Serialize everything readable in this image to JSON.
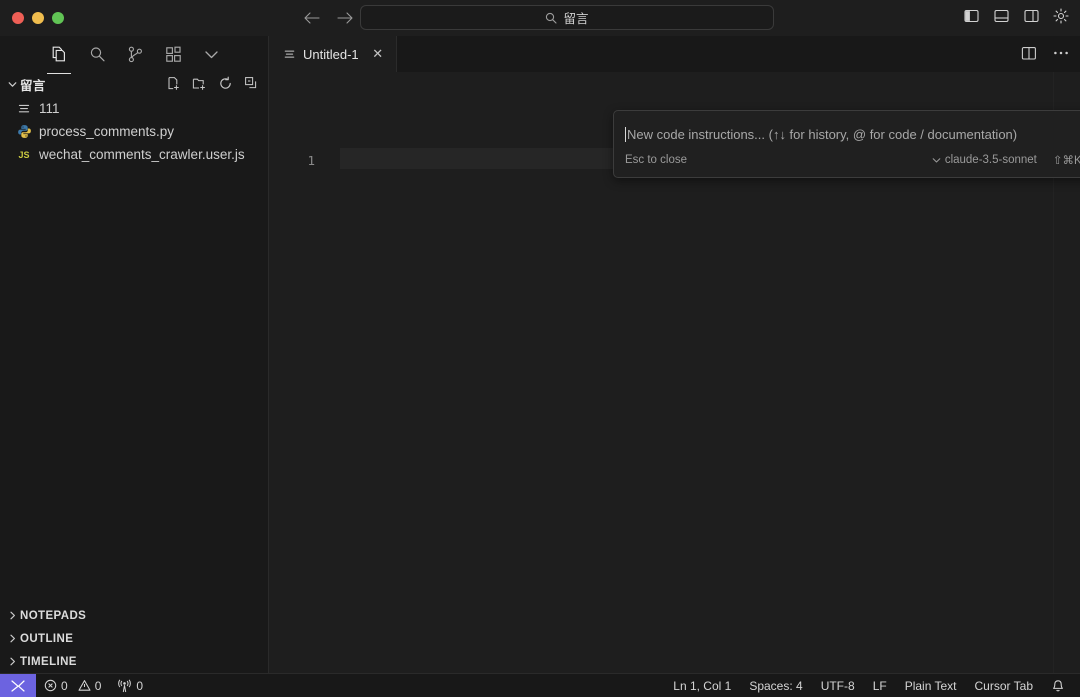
{
  "window": {
    "traffic_lights": [
      "close",
      "minimize",
      "maximize"
    ],
    "colors": {
      "close": "#ee5f56",
      "minimize": "#f0bd4e",
      "maximize": "#61c455",
      "accent": "#6c63e0"
    }
  },
  "titlebar": {
    "back_label": "←",
    "forward_label": "→",
    "search": {
      "icon": "search-icon",
      "value": "留言",
      "placeholder": "留言"
    },
    "actions": [
      {
        "name": "toggle-primary-sidebar",
        "icon": "layout-sidebar-left-icon"
      },
      {
        "name": "toggle-panel",
        "icon": "layout-panel-bottom-icon"
      },
      {
        "name": "toggle-secondary-sidebar",
        "icon": "layout-sidebar-right-icon"
      },
      {
        "name": "manage-settings",
        "icon": "gear-icon"
      }
    ]
  },
  "activitybar": {
    "items": [
      {
        "name": "explorer",
        "icon": "files-icon",
        "active": true
      },
      {
        "name": "search",
        "icon": "search-icon",
        "active": false
      },
      {
        "name": "source-control",
        "icon": "source-control-icon",
        "active": false
      },
      {
        "name": "extensions",
        "icon": "extensions-icon",
        "active": false
      },
      {
        "name": "more-views",
        "icon": "chevron-down-icon",
        "active": false
      }
    ]
  },
  "sidebar": {
    "folder": {
      "label": "留言",
      "expanded": true,
      "chevron": "chevron-down-icon",
      "actions": [
        {
          "name": "new-file",
          "icon": "new-file-icon"
        },
        {
          "name": "new-folder",
          "icon": "new-folder-icon"
        },
        {
          "name": "refresh-explorer",
          "icon": "refresh-icon"
        },
        {
          "name": "collapse-folders",
          "icon": "collapse-all-icon"
        }
      ]
    },
    "files": [
      {
        "name": "111",
        "icon": "text-file-icon",
        "icon_kind": "lines"
      },
      {
        "name": "process_comments.py",
        "icon": "python-file-icon",
        "icon_kind": "python"
      },
      {
        "name": "wechat_comments_crawler.user.js",
        "icon": "javascript-file-icon",
        "icon_kind": "js",
        "badge": "JS"
      }
    ],
    "sections": [
      {
        "label": "NOTEPADS",
        "expanded": false,
        "chevron": "chevron-right-icon"
      },
      {
        "label": "OUTLINE",
        "expanded": false,
        "chevron": "chevron-right-icon"
      },
      {
        "label": "TIMELINE",
        "expanded": false,
        "chevron": "chevron-right-icon"
      }
    ]
  },
  "editor": {
    "tabs": [
      {
        "label": "Untitled-1",
        "icon": "text-file-icon",
        "close_label": "✕",
        "active": true
      }
    ],
    "actions": [
      {
        "name": "split-editor",
        "icon": "split-editor-icon"
      },
      {
        "name": "more-actions",
        "icon": "ellipsis-icon"
      }
    ],
    "line_numbers": [
      "1"
    ],
    "content": ""
  },
  "ai_popup": {
    "placeholder": "New code instructions... (↑↓ for history, @ for code / documentation)",
    "close_label": "✕",
    "esc_hint": "Esc to close",
    "model": "claude-3.5-sonnet",
    "model_chevron": "⌄",
    "toggle_hint": "⇧⌘K to toggle"
  },
  "statusbar": {
    "remote_icon": "remote-host-icon",
    "left": [
      {
        "name": "problems-errors",
        "icon": "error-circle-icon",
        "value": "0"
      },
      {
        "name": "problems-warnings",
        "icon": "warning-triangle-icon",
        "value": "0"
      },
      {
        "name": "ports-forwarded",
        "icon": "radio-tower-icon",
        "value": "0"
      }
    ],
    "right": [
      {
        "name": "cursor-position",
        "label": "Ln 1, Col 1"
      },
      {
        "name": "indentation",
        "label": "Spaces: 4"
      },
      {
        "name": "encoding",
        "label": "UTF-8"
      },
      {
        "name": "end-of-line",
        "label": "LF"
      },
      {
        "name": "language-mode",
        "label": "Plain Text"
      },
      {
        "name": "cursor-tab",
        "label": "Cursor Tab"
      },
      {
        "name": "notifications",
        "label": "",
        "icon": "bell-icon"
      }
    ]
  }
}
